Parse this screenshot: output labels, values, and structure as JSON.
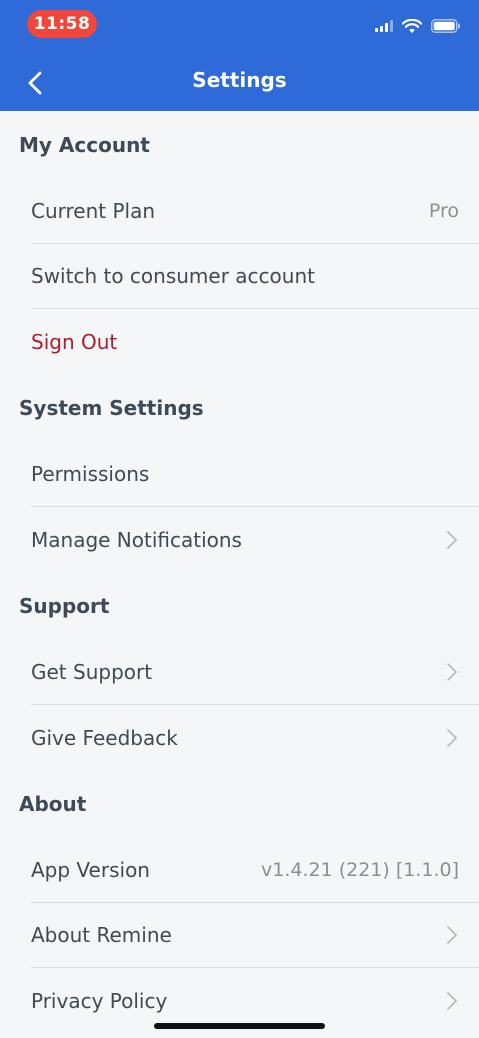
{
  "status_bar": {
    "time": "11:58"
  },
  "header": {
    "title": "Settings"
  },
  "sections": {
    "account": {
      "title": "My Account",
      "current_plan": {
        "label": "Current Plan",
        "value": "Pro"
      },
      "switch_account": {
        "label": "Switch to consumer account"
      },
      "sign_out": {
        "label": "Sign Out",
        "color": "#b01c27"
      }
    },
    "system": {
      "title": "System Settings",
      "permissions": {
        "label": "Permissions"
      },
      "notifications": {
        "label": "Manage Notifications"
      }
    },
    "support": {
      "title": "Support",
      "get_support": {
        "label": "Get Support"
      },
      "feedback": {
        "label": "Give Feedback"
      }
    },
    "about": {
      "title": "About",
      "app_version": {
        "label": "App Version",
        "value": "v1.4.21 (221) [1.1.0]"
      },
      "about_remine": {
        "label": "About Remine"
      },
      "privacy": {
        "label": "Privacy Policy"
      }
    }
  },
  "colors": {
    "header_bg": "#2f6ad9",
    "time_pill": "#f0473c"
  },
  "icons": [
    "chevron-left-icon",
    "chevron-right-icon",
    "cellular-signal-icon",
    "wifi-icon",
    "battery-icon"
  ]
}
